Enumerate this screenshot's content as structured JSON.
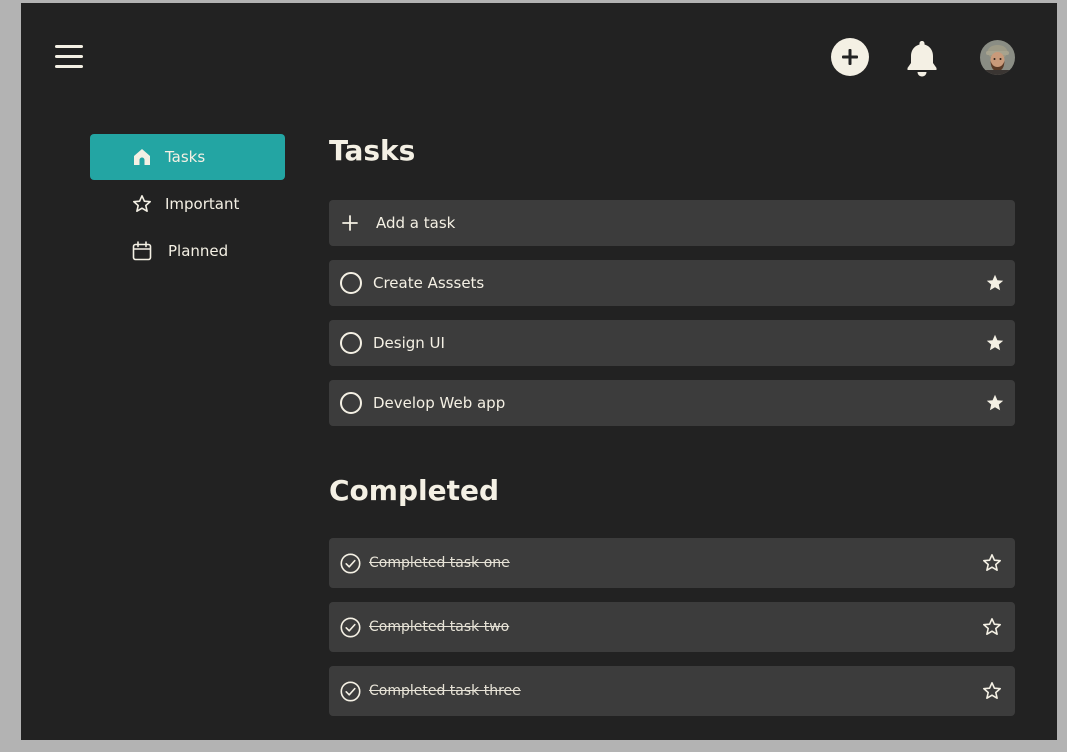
{
  "header": {
    "menu_icon": "hamburger-menu-icon",
    "add_icon": "plus-circle-icon",
    "notifications_icon": "bell-icon",
    "avatar": "user-avatar"
  },
  "sidebar": {
    "items": [
      {
        "label": "Tasks",
        "icon": "home-icon",
        "active": true
      },
      {
        "label": "Important",
        "icon": "star-outline-icon",
        "active": false
      },
      {
        "label": "Planned",
        "icon": "calendar-icon",
        "active": false
      }
    ]
  },
  "main": {
    "title": "Tasks",
    "add_task_placeholder": "Add a task",
    "tasks": [
      {
        "title": "Create Asssets",
        "important": true
      },
      {
        "title": "Design UI",
        "important": true
      },
      {
        "title": "Develop Web app",
        "important": true
      }
    ],
    "completed_title": "Completed",
    "completed": [
      {
        "title": "Completed task one",
        "important": false
      },
      {
        "title": "Completed task two",
        "important": false
      },
      {
        "title": "Completed task three",
        "important": false
      }
    ]
  },
  "colors": {
    "background": "#222222",
    "outer": "#b3b3b3",
    "accent": "#23a5a3",
    "card": "#3c3c3c",
    "text": "#f4f0e4"
  }
}
